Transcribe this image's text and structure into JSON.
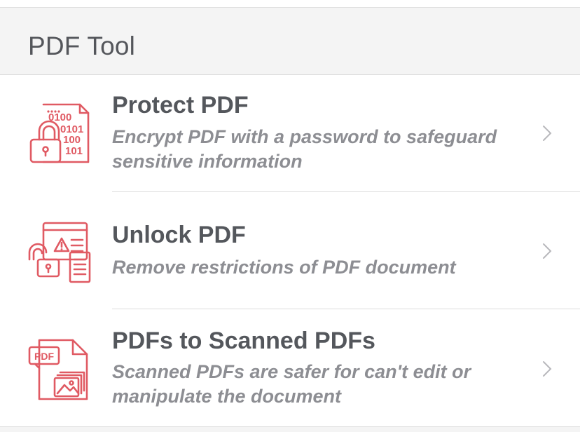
{
  "section": {
    "title": "PDF Tool"
  },
  "rows": [
    {
      "title": "Protect PDF",
      "description": "Encrypt PDF with a password to safeguard sensitive information",
      "icon": "lock-binary-document-icon"
    },
    {
      "title": "Unlock PDF",
      "description": "Remove restrictions of PDF document",
      "icon": "unlock-warning-document-icon"
    },
    {
      "title": "PDFs to Scanned PDFs",
      "description": "Scanned PDFs are safer for can't edit or manipulate the document",
      "icon": "pdf-scanned-images-icon",
      "icon_label": "PDF"
    }
  ],
  "colors": {
    "icon_accent": "#e05a63",
    "title_text": "#54575c",
    "description_text": "#8d8e93",
    "chevron": "#b8b8bc"
  }
}
